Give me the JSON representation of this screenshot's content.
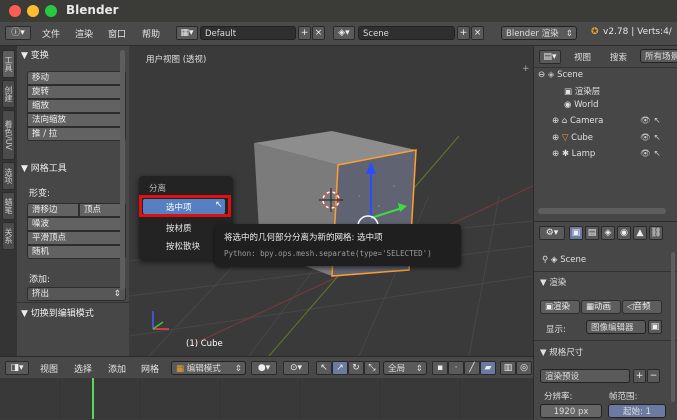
{
  "window": {
    "title": "Blender",
    "traffic_colors": [
      "#fd5d57",
      "#fdbd30",
      "#27c941"
    ]
  },
  "info_header": {
    "menus": [
      "文件",
      "渲染",
      "窗口",
      "帮助"
    ],
    "screen_layout": "Default",
    "scene": "Scene",
    "engine": "Blender 渲染",
    "version": "v2.78 | Verts:4/"
  },
  "left_tabs": [
    "工具",
    "创建",
    "着色/UV",
    "选项",
    "蜡笔",
    "关系"
  ],
  "tool_shelf": {
    "transform_header": "▼ 变换",
    "transform_buttons": [
      "移动",
      "旋转",
      "缩放",
      "法向缩放",
      "推 / 拉"
    ],
    "mesh_tools_header": "▼ 网格工具",
    "deform_label": "形变:",
    "slide_edge": "滑移边",
    "vertex": "顶点",
    "noise": "噪波",
    "smooth_vertex": "平滑顶点",
    "random": "随机",
    "add_label": "添加:",
    "extrude": "挤出",
    "toggle_edit_mode": "▼ 切换到编辑模式"
  },
  "viewport": {
    "label": "用户视图 (透视)",
    "object_label": "(1) Cube"
  },
  "popup": {
    "title": "分离",
    "items": [
      "选中项",
      "按材质",
      "按松散块"
    ],
    "highlight_color": "#e01010"
  },
  "tooltip": {
    "line1": "将选中的几何部分分离为新的网格: 选中项",
    "line2": "Python: bpy.ops.mesh.separate(type='SELECTED')"
  },
  "outliner": {
    "tabs": [
      "视图",
      "搜索",
      "所有场景"
    ],
    "rows": [
      "Scene",
      "渲染层",
      "World",
      "Camera",
      "Cube",
      "Lamp"
    ]
  },
  "properties": {
    "scene_label": "Scene",
    "render_header": "▼ 渲染",
    "render_buttons": [
      "渲染",
      "动画",
      "音频"
    ],
    "display_label": "显示:",
    "display_value": "图像编辑器",
    "dimensions_header": "▼ 规格尺寸",
    "render_preset": "渲染预设",
    "resolution_label": "分辨率:",
    "frame_range_label": "帧范围:",
    "res_x": "1920 px",
    "start_label": "起始: 1"
  },
  "view3d_header": {
    "menus": [
      "视图",
      "选择",
      "添加",
      "网格"
    ],
    "mode": "编辑模式",
    "pivot": "全局"
  }
}
